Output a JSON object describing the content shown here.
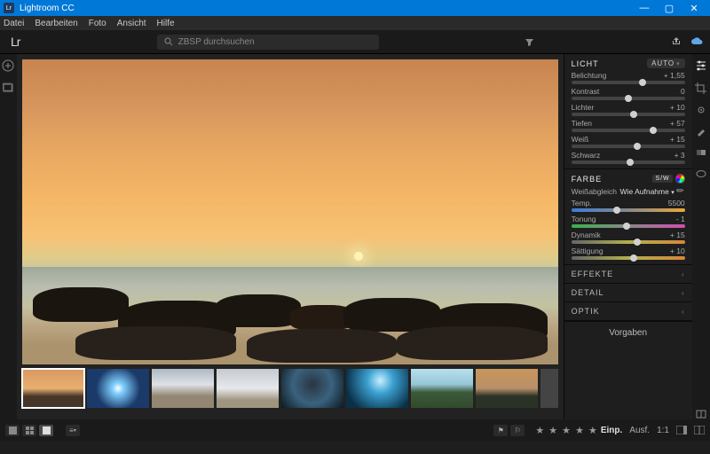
{
  "window": {
    "title": "Lightroom CC",
    "logo": "Lr"
  },
  "menu": [
    "Datei",
    "Bearbeiten",
    "Foto",
    "Ansicht",
    "Hilfe"
  ],
  "topbar": {
    "logo": "Lr",
    "search_placeholder": "ZBSP durchsuchen"
  },
  "panels": {
    "licht": {
      "title": "LICHT",
      "auto": "AUTO",
      "sliders": [
        {
          "label": "Belichtung",
          "value": "+ 1,55",
          "pos": 63
        },
        {
          "label": "Kontrast",
          "value": "0",
          "pos": 50
        },
        {
          "label": "Lichter",
          "value": "+ 10",
          "pos": 55
        },
        {
          "label": "Tiefen",
          "value": "+ 57",
          "pos": 72
        },
        {
          "label": "Weiß",
          "value": "+ 15",
          "pos": 58
        },
        {
          "label": "Schwarz",
          "value": "+ 3",
          "pos": 52
        }
      ]
    },
    "farbe": {
      "title": "FARBE",
      "bw": "S/W",
      "wb_label": "Weißabgleich",
      "wb_value": "Wie Aufnahme",
      "sliders": [
        {
          "label": "Temp.",
          "value": "5500",
          "pos": 40,
          "cls": "temp"
        },
        {
          "label": "Tonung",
          "value": "- 1",
          "pos": 49,
          "cls": "tint"
        },
        {
          "label": "Dynamik",
          "value": "+ 15",
          "pos": 58,
          "cls": "vib"
        },
        {
          "label": "Sättigung",
          "value": "+ 10",
          "pos": 55,
          "cls": "sat"
        }
      ]
    },
    "collapsed": [
      {
        "title": "EFFEKTE"
      },
      {
        "title": "DETAIL"
      },
      {
        "title": "OPTIK"
      }
    ],
    "presets": "Vorgaben"
  },
  "bottombar": {
    "fit": "Einp.",
    "fill": "Ausf.",
    "oneone": "1:1"
  }
}
